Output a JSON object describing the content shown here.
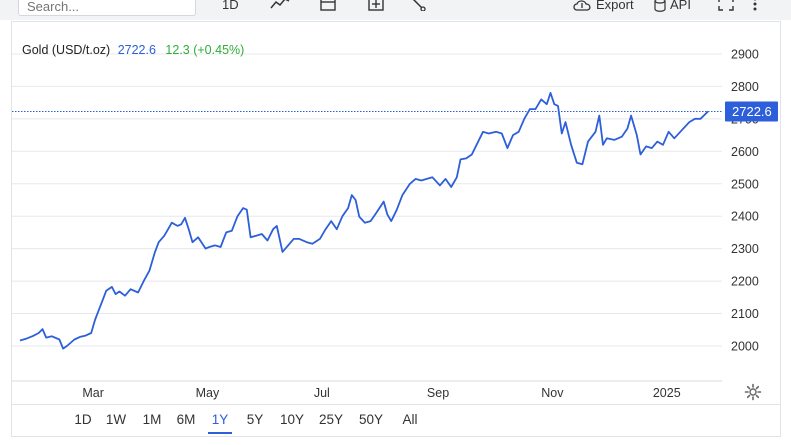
{
  "toolbar": {
    "search_placeholder": "Search...",
    "interval_label": "1D",
    "export_label": "Export",
    "api_label": "API"
  },
  "quote": {
    "name": "Gold (USD/t.oz)",
    "last": "2722.6",
    "change": "12.3 (+0.45%)"
  },
  "colors": {
    "line": "#2c5fd9",
    "change_positive": "#2fae3a",
    "grid": "#e6e8eb"
  },
  "ranges": [
    "1D",
    "1W",
    "1M",
    "6M",
    "1Y",
    "5Y",
    "10Y",
    "25Y",
    "50Y",
    "All"
  ],
  "active_range": "1Y",
  "chart_data": {
    "type": "line",
    "title": "Gold (USD/t.oz)",
    "ylim": [
      1900,
      2950
    ],
    "yticks": [
      2000,
      2100,
      2200,
      2300,
      2400,
      2500,
      2600,
      2700,
      2800,
      2900
    ],
    "xlim": [
      "2024-01-22",
      "2025-01-23"
    ],
    "xticks": [
      {
        "label": "Mar",
        "date": "2024-03-01"
      },
      {
        "label": "May",
        "date": "2024-05-01"
      },
      {
        "label": "Jul",
        "date": "2024-07-01"
      },
      {
        "label": "Sep",
        "date": "2024-09-01"
      },
      {
        "label": "Nov",
        "date": "2024-11-01"
      },
      {
        "label": "2025",
        "date": "2025-01-01"
      }
    ],
    "last_value_label": "2722.6",
    "last_value": 2722.6,
    "grid": true,
    "series": [
      {
        "points": [
          [
            "2024-01-22",
            2017
          ],
          [
            "2024-01-25",
            2022
          ],
          [
            "2024-01-29",
            2031
          ],
          [
            "2024-02-01",
            2040
          ],
          [
            "2024-02-03",
            2052
          ],
          [
            "2024-02-05",
            2026
          ],
          [
            "2024-02-08",
            2030
          ],
          [
            "2024-02-12",
            2020
          ],
          [
            "2024-02-14",
            1992
          ],
          [
            "2024-02-16",
            2000
          ],
          [
            "2024-02-20",
            2020
          ],
          [
            "2024-02-23",
            2028
          ],
          [
            "2024-02-26",
            2032
          ],
          [
            "2024-02-29",
            2040
          ],
          [
            "2024-03-02",
            2080
          ],
          [
            "2024-03-04",
            2110
          ],
          [
            "2024-03-06",
            2140
          ],
          [
            "2024-03-08",
            2170
          ],
          [
            "2024-03-11",
            2182
          ],
          [
            "2024-03-13",
            2160
          ],
          [
            "2024-03-15",
            2168
          ],
          [
            "2024-03-18",
            2155
          ],
          [
            "2024-03-21",
            2175
          ],
          [
            "2024-03-25",
            2165
          ],
          [
            "2024-03-28",
            2200
          ],
          [
            "2024-03-31",
            2232
          ],
          [
            "2024-04-03",
            2290
          ],
          [
            "2024-04-05",
            2320
          ],
          [
            "2024-04-08",
            2340
          ],
          [
            "2024-04-10",
            2360
          ],
          [
            "2024-04-12",
            2380
          ],
          [
            "2024-04-15",
            2370
          ],
          [
            "2024-04-17",
            2375
          ],
          [
            "2024-04-19",
            2395
          ],
          [
            "2024-04-21",
            2360
          ],
          [
            "2024-04-23",
            2320
          ],
          [
            "2024-04-26",
            2335
          ],
          [
            "2024-04-30",
            2300
          ],
          [
            "2024-05-02",
            2305
          ],
          [
            "2024-05-05",
            2310
          ],
          [
            "2024-05-08",
            2305
          ],
          [
            "2024-05-11",
            2350
          ],
          [
            "2024-05-14",
            2355
          ],
          [
            "2024-05-17",
            2400
          ],
          [
            "2024-05-20",
            2425
          ],
          [
            "2024-05-22",
            2420
          ],
          [
            "2024-05-24",
            2335
          ],
          [
            "2024-05-27",
            2340
          ],
          [
            "2024-05-30",
            2345
          ],
          [
            "2024-06-02",
            2325
          ],
          [
            "2024-06-05",
            2360
          ],
          [
            "2024-06-07",
            2370
          ],
          [
            "2024-06-10",
            2290
          ],
          [
            "2024-06-13",
            2310
          ],
          [
            "2024-06-16",
            2330
          ],
          [
            "2024-06-19",
            2330
          ],
          [
            "2024-06-23",
            2320
          ],
          [
            "2024-06-26",
            2315
          ],
          [
            "2024-06-30",
            2330
          ],
          [
            "2024-07-03",
            2360
          ],
          [
            "2024-07-06",
            2385
          ],
          [
            "2024-07-09",
            2360
          ],
          [
            "2024-07-12",
            2400
          ],
          [
            "2024-07-15",
            2425
          ],
          [
            "2024-07-17",
            2465
          ],
          [
            "2024-07-19",
            2450
          ],
          [
            "2024-07-21",
            2398
          ],
          [
            "2024-07-24",
            2380
          ],
          [
            "2024-07-27",
            2385
          ],
          [
            "2024-07-30",
            2410
          ],
          [
            "2024-08-03",
            2445
          ],
          [
            "2024-08-05",
            2405
          ],
          [
            "2024-08-07",
            2385
          ],
          [
            "2024-08-10",
            2420
          ],
          [
            "2024-08-13",
            2465
          ],
          [
            "2024-08-17",
            2500
          ],
          [
            "2024-08-20",
            2515
          ],
          [
            "2024-08-23",
            2510
          ],
          [
            "2024-08-26",
            2515
          ],
          [
            "2024-08-29",
            2520
          ],
          [
            "2024-09-02",
            2495
          ],
          [
            "2024-09-05",
            2515
          ],
          [
            "2024-09-08",
            2490
          ],
          [
            "2024-09-11",
            2520
          ],
          [
            "2024-09-13",
            2575
          ],
          [
            "2024-09-16",
            2578
          ],
          [
            "2024-09-19",
            2590
          ],
          [
            "2024-09-22",
            2625
          ],
          [
            "2024-09-25",
            2660
          ],
          [
            "2024-09-28",
            2655
          ],
          [
            "2024-10-02",
            2660
          ],
          [
            "2024-10-05",
            2655
          ],
          [
            "2024-10-08",
            2610
          ],
          [
            "2024-10-11",
            2650
          ],
          [
            "2024-10-14",
            2660
          ],
          [
            "2024-10-17",
            2700
          ],
          [
            "2024-10-20",
            2730
          ],
          [
            "2024-10-23",
            2730
          ],
          [
            "2024-10-26",
            2760
          ],
          [
            "2024-10-29",
            2745
          ],
          [
            "2024-10-31",
            2780
          ],
          [
            "2024-11-02",
            2745
          ],
          [
            "2024-11-04",
            2740
          ],
          [
            "2024-11-06",
            2655
          ],
          [
            "2024-11-08",
            2690
          ],
          [
            "2024-11-11",
            2620
          ],
          [
            "2024-11-14",
            2565
          ],
          [
            "2024-11-17",
            2560
          ],
          [
            "2024-11-20",
            2630
          ],
          [
            "2024-11-24",
            2660
          ],
          [
            "2024-11-26",
            2710
          ],
          [
            "2024-11-28",
            2620
          ],
          [
            "2024-11-30",
            2640
          ],
          [
            "2024-12-04",
            2635
          ],
          [
            "2024-12-08",
            2645
          ],
          [
            "2024-12-11",
            2670
          ],
          [
            "2024-12-13",
            2710
          ],
          [
            "2024-12-16",
            2650
          ],
          [
            "2024-12-18",
            2590
          ],
          [
            "2024-12-21",
            2615
          ],
          [
            "2024-12-24",
            2610
          ],
          [
            "2024-12-27",
            2630
          ],
          [
            "2024-12-30",
            2620
          ],
          [
            "2025-01-02",
            2660
          ],
          [
            "2025-01-05",
            2640
          ],
          [
            "2025-01-09",
            2665
          ],
          [
            "2025-01-13",
            2690
          ],
          [
            "2025-01-16",
            2700
          ],
          [
            "2025-01-19",
            2700
          ],
          [
            "2025-01-23",
            2722.6
          ]
        ]
      }
    ]
  }
}
